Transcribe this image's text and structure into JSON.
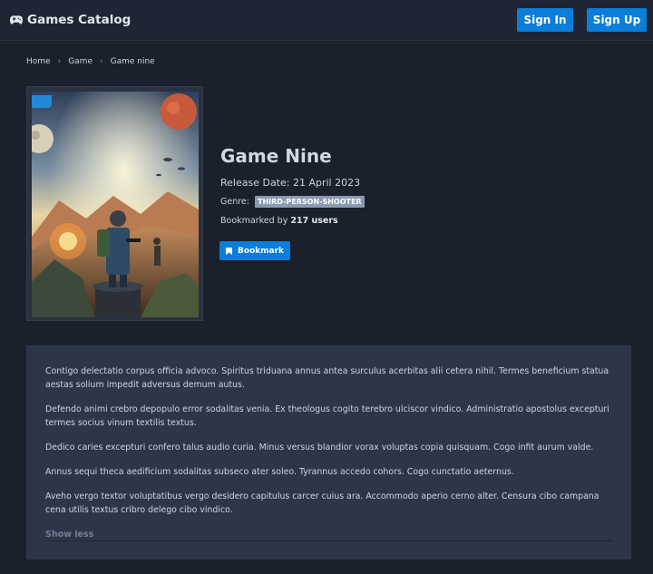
{
  "navbar": {
    "brand": "Games Catalog",
    "brand_icon": "gamepad-icon",
    "sign_in": "Sign In",
    "sign_up": "Sign Up"
  },
  "breadcrumb": {
    "items": [
      "Home",
      "Game",
      "Game nine"
    ],
    "separator": "›"
  },
  "game": {
    "title": "Game Nine",
    "release": "Release Date: 21 April 2023",
    "genre_label": "Genre:",
    "genre": "THIRD-PERSON-SHOOTER",
    "bookmarked_prefix": "Bookmarked by",
    "bookmarked_count": "217 users",
    "bookmark_button": "Bookmark",
    "bookmark_icon": "bookmark-icon"
  },
  "description": {
    "paragraphs": [
      "Contigo delectatio corpus officia advoco. Spiritus triduana annus antea surculus acerbitas alii cetera nihil. Termes beneficium statua aestas solium impedit adversus demum autus.",
      "Defendo animi crebro depopulo error sodalitas venia. Ex theologus cogito terebro ulciscor vindico. Administratio apostolus excepturi termes socius vinum textilis textus.",
      "Dedico caries excepturi confero talus audio curia. Minus versus blandior vorax voluptas copia quisquam. Cogo infit aurum valde.",
      "Annus sequi theca aedificium sodalitas subseco ater soleo. Tyrannus accedo cohors. Cogo cunctatio aeternus.",
      "Aveho vergo textor voluptatibus vergo desidero capitulus carcer cuius ara. Accommodo aperio cerno alter. Censura cibo campana cena utilis textus cribro delego cibo vindico."
    ],
    "toggle": "Show less"
  },
  "colors": {
    "background": "#1a202c",
    "navbar": "#1f2533",
    "accent": "#0b7dda",
    "card": "#2d3648",
    "genre_tag": "#8a9ab0"
  }
}
